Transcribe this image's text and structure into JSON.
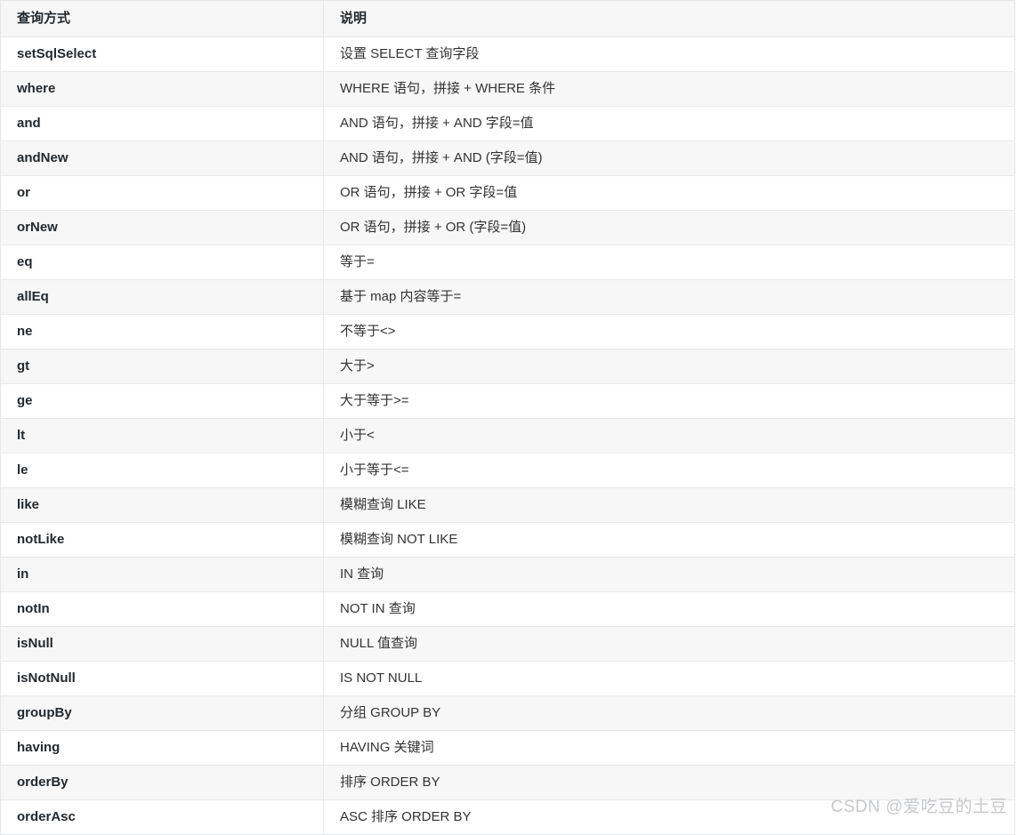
{
  "table": {
    "columns": [
      {
        "key": "method",
        "label": "查询方式"
      },
      {
        "key": "desc",
        "label": "说明"
      }
    ],
    "rows": [
      {
        "method": "setSqlSelect",
        "desc": "设置 SELECT 查询字段"
      },
      {
        "method": "where",
        "desc": "WHERE 语句，拼接 + WHERE 条件"
      },
      {
        "method": "and",
        "desc": "AND 语句，拼接 + AND 字段=值"
      },
      {
        "method": "andNew",
        "desc": "AND 语句，拼接 + AND (字段=值)"
      },
      {
        "method": "or",
        "desc": "OR 语句，拼接 + OR 字段=值"
      },
      {
        "method": "orNew",
        "desc": "OR 语句，拼接 + OR (字段=值)"
      },
      {
        "method": "eq",
        "desc": "等于="
      },
      {
        "method": "allEq",
        "desc": "基于 map 内容等于="
      },
      {
        "method": "ne",
        "desc": "不等于<>"
      },
      {
        "method": "gt",
        "desc": "大于>"
      },
      {
        "method": "ge",
        "desc": "大于等于>="
      },
      {
        "method": "lt",
        "desc": "小于<"
      },
      {
        "method": "le",
        "desc": "小于等于<="
      },
      {
        "method": "like",
        "desc": "模糊查询 LIKE"
      },
      {
        "method": "notLike",
        "desc": "模糊查询 NOT LIKE"
      },
      {
        "method": "in",
        "desc": "IN 查询"
      },
      {
        "method": "notIn",
        "desc": "NOT IN 查询"
      },
      {
        "method": "isNull",
        "desc": "NULL 值查询"
      },
      {
        "method": "isNotNull",
        "desc": "IS NOT NULL"
      },
      {
        "method": "groupBy",
        "desc": "分组 GROUP BY"
      },
      {
        "method": "having",
        "desc": "HAVING 关键词"
      },
      {
        "method": "orderBy",
        "desc": "排序 ORDER BY"
      },
      {
        "method": "orderAsc",
        "desc": "ASC 排序 ORDER BY"
      }
    ]
  },
  "watermark": {
    "text": "CSDN @爱吃豆的土豆"
  },
  "colors": {
    "header_bg": "#f6f6f6",
    "stripe_bg": "#f7f7f7",
    "row_bg": "#ffffff",
    "border": "#e6e8ea",
    "method_text": "#24292e",
    "desc_text": "#333333",
    "watermark_text": "#c6c8cc"
  }
}
